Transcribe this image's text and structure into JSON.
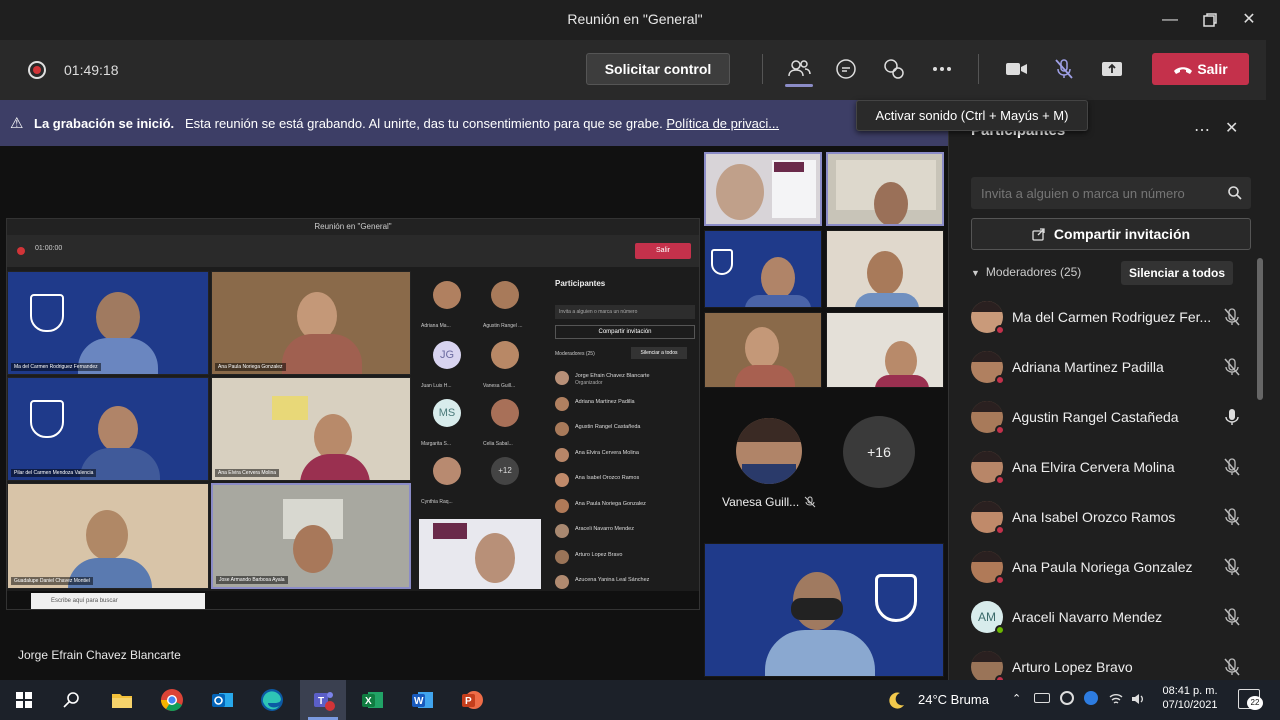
{
  "window": {
    "title": "Reunión en \"General\""
  },
  "toolbar": {
    "timer": "01:49:18",
    "request_control": "Solicitar control",
    "leave": "Salir",
    "tooltip": "Activar sonido (Ctrl + Mayús + M)"
  },
  "banner": {
    "bold": "La grabación se inició.",
    "text": "Esta reunión se está grabando. Al unirte, das tu consentimiento para que se grabe.",
    "link": "Política de privaci..."
  },
  "stage": {
    "presenter": "Jorge Efrain Chavez Blancarte",
    "vanesa": "Vanesa Guill...",
    "overflow": "+16"
  },
  "shared_screen": {
    "title": "Reunión en \"General\"",
    "timer": "01:00:00",
    "leave": "Salir",
    "panel_title": "Participantes",
    "panel_search": "Invita a alguien o marca un número",
    "panel_share": "Compartir invitación",
    "moderators": "Moderadores (25)",
    "mute_all": "Silenciar a todos",
    "organizer": "Organizador",
    "taskbar_search": "Escribe aquí para buscar",
    "overflow": "+12",
    "tile_names": [
      "Ma del Carmen Rodriguez Fernandez",
      "Ana Paula Noriega Gonzalez",
      "Pilar del Carmen Mendoza Valencia",
      "Ana Elvira Cervera Molina",
      "Guadalupe Daniel Chavez Montiel",
      "Jose Armando Barbosa Ayala"
    ],
    "people": [
      "Adriana Ma...",
      "Agustin Rangel ...",
      "Juan Luis H...",
      "Vanesa Guill...",
      "Margarita S...",
      "Celia Sabal...",
      "Cynthia Raq..."
    ],
    "initials": [
      "JG",
      "MS"
    ],
    "list": [
      "Jorge Efrain Chavez Blancarte",
      "Adriana Martinez Padilla",
      "Agustin Rangel Castañeda",
      "Ana Elvira Cervera Molina",
      "Ana Isabel Orozco Ramos",
      "Ana Paula Noriega Gonzalez",
      "Araceli Navarro Mendez",
      "Arturo Lopez Bravo",
      "Azucena Yanina Leal Sánchez"
    ]
  },
  "panel": {
    "title": "Participantes",
    "search_placeholder": "Invita a alguien o marca un número",
    "share": "Compartir invitación",
    "moderators": "Moderadores (25)",
    "mute_all": "Silenciar a todos",
    "participants": [
      {
        "name": "Ma del Carmen Rodriguez Fer...",
        "mic": "muted",
        "skin": "#c99a7a"
      },
      {
        "name": "Adriana Martinez Padilla",
        "mic": "muted",
        "skin": "#b08060"
      },
      {
        "name": "Agustin Rangel Castañeda",
        "mic": "on",
        "skin": "#a87a5a"
      },
      {
        "name": "Ana Elvira Cervera Molina",
        "mic": "muted",
        "skin": "#b88668"
      },
      {
        "name": "Ana Isabel Orozco Ramos",
        "mic": "muted",
        "skin": "#c08a6a"
      },
      {
        "name": "Ana Paula Noriega Gonzalez",
        "mic": "muted",
        "skin": "#b07a58"
      },
      {
        "name": "Araceli Navarro Mendez",
        "mic": "muted",
        "initials": "AM"
      },
      {
        "name": "Arturo Lopez Bravo",
        "mic": "muted",
        "skin": "#9a7458"
      }
    ]
  },
  "taskbar": {
    "weather": "24°C  Bruma",
    "time": "08:41 p. m.",
    "date": "07/10/2021",
    "notifications": "22"
  },
  "colors": {
    "leave": "#c4314b",
    "banner": "#3d3e66",
    "accent": "#8b8cc7"
  }
}
